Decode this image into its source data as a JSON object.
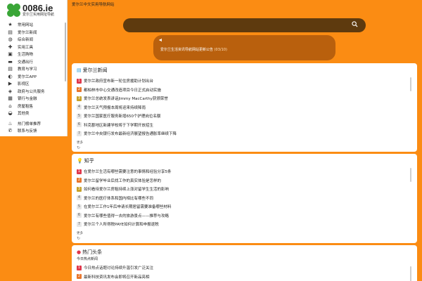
{
  "site": {
    "brand": "0086.ie",
    "tagline": "爱尔兰实用网址导航",
    "top_title": "爱尔兰中文实用导航网站"
  },
  "sidebar": {
    "items": [
      {
        "icon": "star-icon",
        "glyph": "★",
        "label": "常用网站"
      },
      {
        "icon": "news-icon",
        "glyph": "▤",
        "label": "爱尔兰新闻"
      },
      {
        "icon": "globe-icon",
        "glyph": "◍",
        "label": "综合新闻"
      },
      {
        "icon": "tools-icon",
        "glyph": "✚",
        "label": "实用工具"
      },
      {
        "icon": "shop-icon",
        "glyph": "▣",
        "label": "生活购物"
      },
      {
        "icon": "car-icon",
        "glyph": "▬",
        "label": "交通出行"
      },
      {
        "icon": "education-icon",
        "glyph": "▤",
        "label": "教育与学习"
      },
      {
        "icon": "app-icon",
        "glyph": "◐",
        "label": "爱尔兰APP"
      },
      {
        "icon": "video-icon",
        "glyph": "▶",
        "label": "影视区"
      },
      {
        "icon": "shield-icon",
        "glyph": "◈",
        "label": "政府与公共服务"
      },
      {
        "icon": "bank-icon",
        "glyph": "▦",
        "label": "银行与金融"
      },
      {
        "icon": "home-icon",
        "glyph": "⌂",
        "label": "房屋租售"
      },
      {
        "icon": "handshake-icon",
        "glyph": "◒",
        "label": "其他类"
      }
    ],
    "extra_items": [
      {
        "icon": "fire-icon",
        "glyph": "♨",
        "label": "热门榜单推荐"
      },
      {
        "icon": "phone-icon",
        "glyph": "✆",
        "label": "联系与反馈"
      }
    ]
  },
  "search": {
    "placeholder": ""
  },
  "notice": {
    "text": "爱尔兰生活资讯导航网站更新公告",
    "date": "(03/10)"
  },
  "cards": [
    {
      "icon": "news-icon",
      "glyph": "▤",
      "title": "爱尔兰新闻",
      "subtitle": "",
      "items": [
        "爱尔兰政府宣布新一轮住房援助计划出台",
        "都柏林市中心交通改造项目今日正式启动实施",
        "爱尔兰总统发表讲话Jimmy MacCarthy获颁荣誉",
        "爱尔兰天气预报本周将迎来持续降雨",
        "爱尔兰国家医疗服务新增650个护理岗位名额",
        "科克郡地区新建学校将于下学期开放招生",
        "爱尔兰中央银行发布最新经济展望报告通胀率继续下降"
      ],
      "more": "更多",
      "refresh": "↻"
    },
    {
      "icon": "bulb-icon",
      "glyph": "💡",
      "title": "知乎",
      "subtitle": "",
      "items": [
        "在爱尔兰生活有哪些需要注意的事情和经验分享5条",
        "爱尔兰留学毕业后找工作的真实体验是怎样的",
        "如何看待爱尔兰房租持续上涨对留学生生活的影响",
        "爱尔兰的医疗体系和国内相比有哪些不同",
        "在爱尔兰工作1年后申请长期居留需要准备哪些材料",
        "爱尔兰有哪些值得一去的旅游景点——推荐与攻略",
        "爱尔兰个人所得税PAYE如何计算和申报退税"
      ],
      "more": "更多",
      "refresh": "↻"
    },
    {
      "icon": "apple-icon",
      "glyph": "●",
      "title": "热门头条",
      "subtitle": "今日热点新闻",
      "items": [
        "今日热点话题讨论持续升温引发广泛关注",
        "最新科技资讯发布会即将召开新品亮相"
      ],
      "more": "",
      "refresh": ""
    }
  ]
}
